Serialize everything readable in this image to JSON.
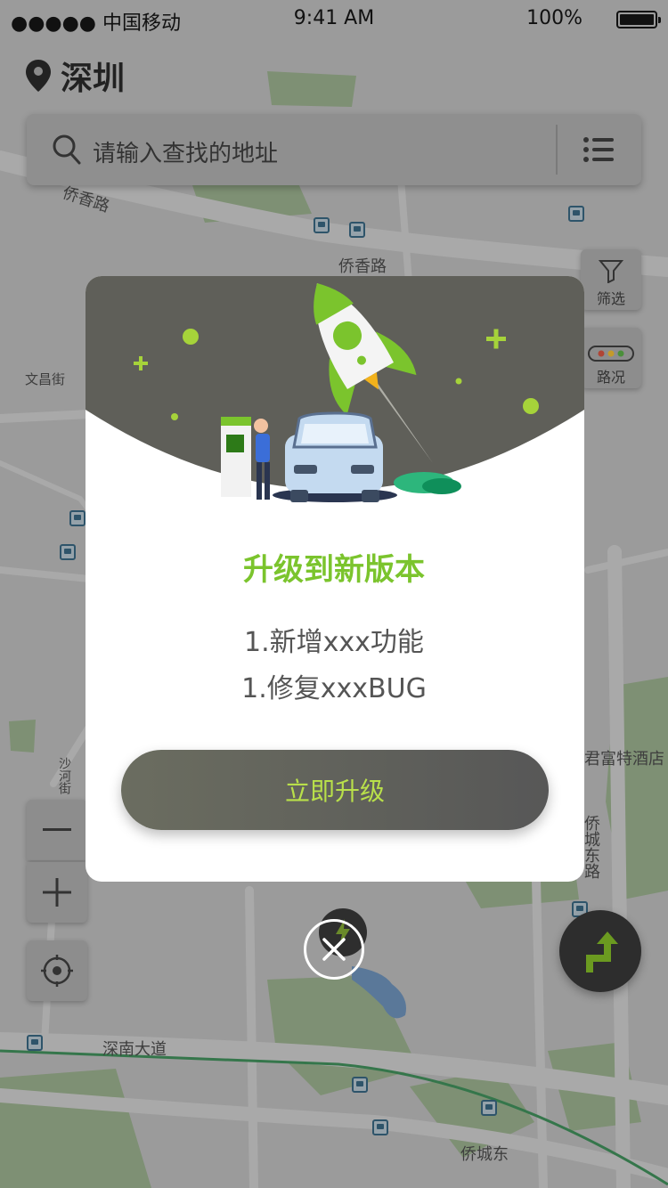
{
  "status_bar": {
    "carrier": "●●●●● 中国移动",
    "time": "9:41 AM",
    "battery_text": "100%"
  },
  "header": {
    "city": "深圳"
  },
  "search": {
    "placeholder": "请输入查找的地址"
  },
  "side_controls": {
    "filter_label": "筛选",
    "traffic_label": "路况"
  },
  "map_labels": {
    "road_1": "侨香路",
    "road_2": "侨香路",
    "street_1": "文昌街",
    "hotel": "君富特酒店",
    "road_3": "侨城东路",
    "road_4": "深南大道",
    "road_5": "沙河街",
    "road_6": "侨城东",
    "road_7": "沙河",
    "road_8": "侨城东"
  },
  "modal": {
    "title": "升级到新版本",
    "notes": [
      "1.新增xxx功能",
      "1.修复xxxBUG"
    ],
    "button_label": "立即升级"
  },
  "colors": {
    "accent_green": "#7bc42d",
    "button_text": "#b9e04a",
    "dark_header": "#5f5f59"
  },
  "icons": {
    "location": "location-pin-icon",
    "search": "search-icon",
    "list": "list-icon",
    "filter": "filter-icon",
    "traffic": "traffic-light-icon",
    "zoom_out": "minus-icon",
    "zoom_in": "plus-icon",
    "locate": "crosshair-icon",
    "close": "close-icon",
    "navigate": "navigation-arrow-icon"
  }
}
